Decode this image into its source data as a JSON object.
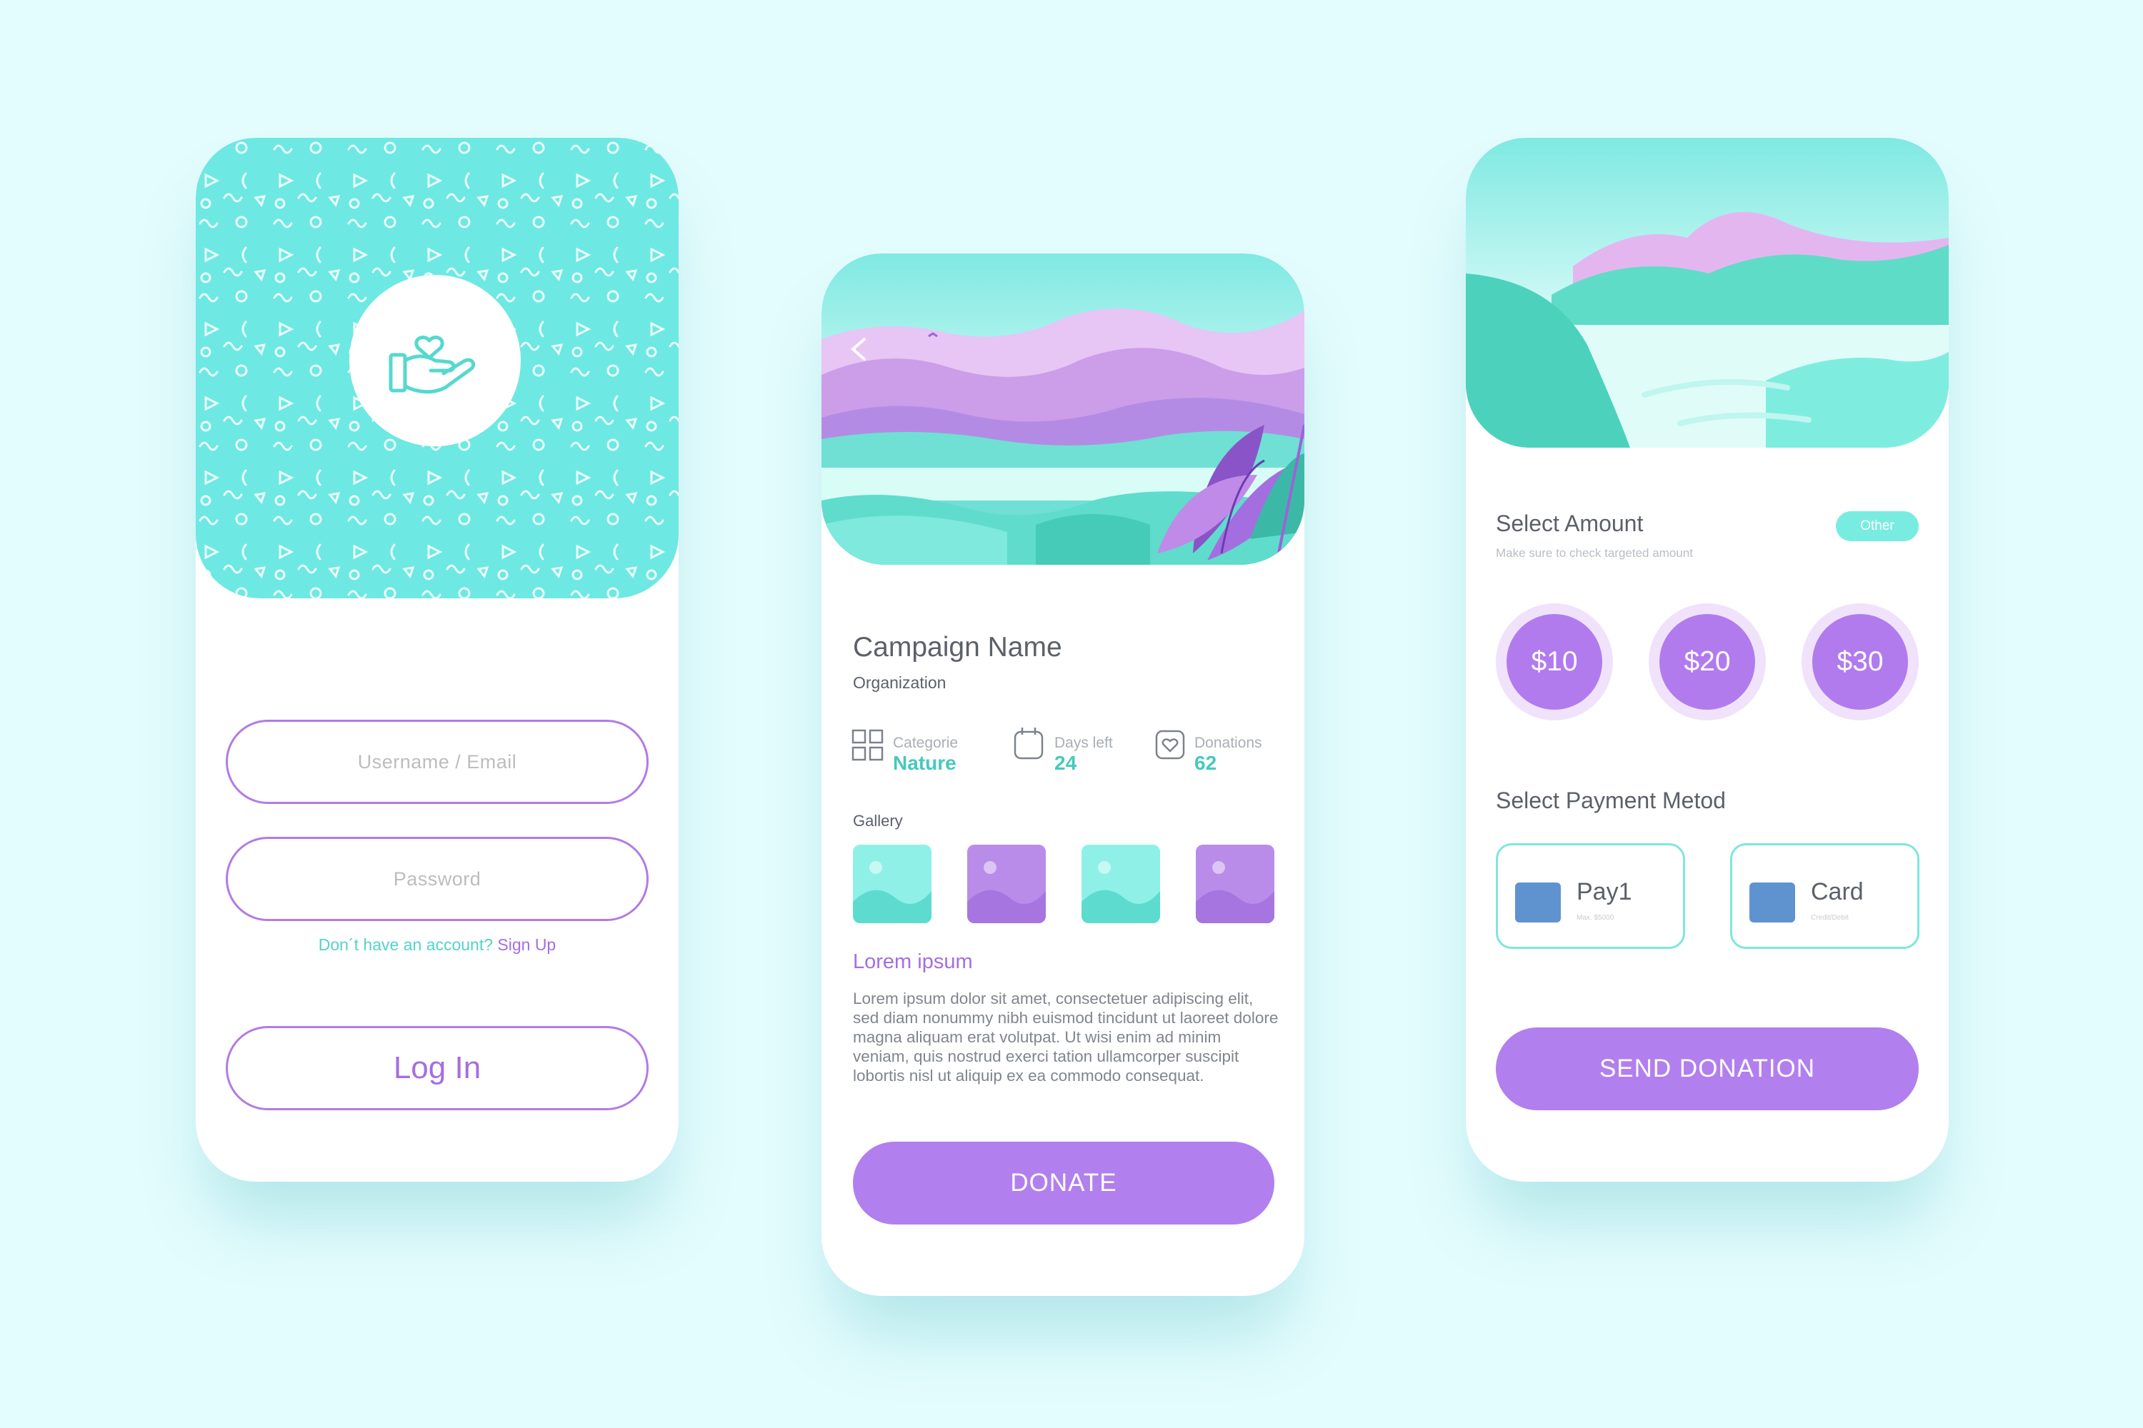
{
  "login": {
    "username_placeholder": "Username / Email",
    "password_placeholder": "Password",
    "no_account_text": "Don´t have  an account?",
    "signup_link": "Sign Up",
    "login_button": "Log In"
  },
  "campaign": {
    "name": "Campaign Name",
    "organization": "Organization",
    "stats": [
      {
        "label": "Categorie",
        "value": "Nature",
        "icon": "grid-icon"
      },
      {
        "label": "Days left",
        "value": "24",
        "icon": "calendar-icon"
      },
      {
        "label": "Donations",
        "value": "62",
        "icon": "heart-icon"
      }
    ],
    "gallery_label": "Gallery",
    "lorem_title": "Lorem ipsum",
    "lorem_body": "Lorem ipsum dolor sit amet, consectetuer adipiscing elit, sed diam nonummy nibh euismod tincidunt ut laoreet dolore magna aliquam erat volutpat. Ut wisi enim ad minim veniam, quis nostrud exerci tation ullamcorper suscipit lobortis nisl ut aliquip ex ea commodo consequat.",
    "donate_button": "DONATE"
  },
  "donation": {
    "select_amount": "Select Amount",
    "hint": "Make sure to check targeted amount",
    "other_badge": "Other",
    "amounts": [
      "$10",
      "$20",
      "$30"
    ],
    "payment_title": "Select Payment Metod",
    "payment_methods": [
      {
        "name": "Pay1",
        "sub": "Max. $5000"
      },
      {
        "name": "Card",
        "sub": "Credit/Debit"
      }
    ],
    "send_button": "SEND DONATION"
  },
  "colors": {
    "background": "#e3fcfd",
    "teal": "#6ee8e2",
    "purple": "#b27fee",
    "text": "#5c6069"
  }
}
